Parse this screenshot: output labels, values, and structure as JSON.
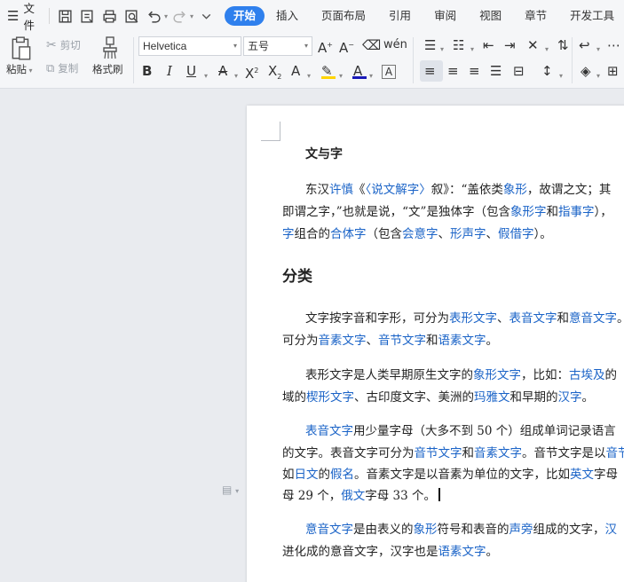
{
  "menubar": {
    "file_label": "文件",
    "tabs": [
      {
        "label": "开始",
        "active": true
      },
      {
        "label": "插入"
      },
      {
        "label": "页面布局"
      },
      {
        "label": "引用"
      },
      {
        "label": "审阅"
      },
      {
        "label": "视图"
      },
      {
        "label": "章节"
      },
      {
        "label": "开发工具"
      }
    ],
    "quick_icons": [
      "save-icon",
      "export-pdf-icon",
      "print-icon",
      "print-preview-icon",
      "undo-icon",
      "redo-icon",
      "customize-icon"
    ]
  },
  "ribbon": {
    "paste_label": "粘贴",
    "cut_label": "剪切",
    "copy_label": "复制",
    "format_painter_label": "格式刷",
    "font_name": "Helvetica",
    "font_size": "五号",
    "accent_color": "#2f80ed",
    "highlight_color": "#ffd400",
    "font_color": "#1a1ab8"
  },
  "document": {
    "title": "文与字",
    "p1": {
      "l1": [
        {
          "t": "东汉"
        },
        {
          "t": "许慎",
          "link": true
        },
        {
          "t": "《"
        },
        {
          "t": "〈说文解字〉",
          "link": true
        },
        {
          "t": "叙》："
        },
        {
          "t": "“盖依类"
        },
        {
          "t": "象形",
          "link": true
        },
        {
          "t": "，故谓之文；其"
        }
      ],
      "l2": [
        {
          "t": "即谓之字，”也就是说，“文”是独体字（包含"
        },
        {
          "t": "象形字",
          "link": true
        },
        {
          "t": "和"
        },
        {
          "t": "指事字",
          "link": true
        },
        {
          "t": "），"
        }
      ],
      "l3": [
        {
          "t": "字",
          "link": true
        },
        {
          "t": "组合的"
        },
        {
          "t": "合体字",
          "link": true
        },
        {
          "t": "（包含"
        },
        {
          "t": "会意字",
          "link": true
        },
        {
          "t": "、"
        },
        {
          "t": "形声字",
          "link": true
        },
        {
          "t": "、"
        },
        {
          "t": "假借字",
          "link": true
        },
        {
          "t": "）。"
        }
      ]
    },
    "section_heading": "分类",
    "p2": {
      "l1": [
        {
          "t": "文字按字音和字形，可分为"
        },
        {
          "t": "表形文字",
          "link": true
        },
        {
          "t": "、"
        },
        {
          "t": "表音文字",
          "link": true
        },
        {
          "t": "和"
        },
        {
          "t": "意音文字",
          "link": true
        },
        {
          "t": "。"
        }
      ],
      "l2": [
        {
          "t": "可分为"
        },
        {
          "t": "音素文字",
          "link": true
        },
        {
          "t": "、"
        },
        {
          "t": "音节文字",
          "link": true
        },
        {
          "t": "和"
        },
        {
          "t": "语素文字",
          "link": true
        },
        {
          "t": "。"
        }
      ]
    },
    "p3": {
      "l1": [
        {
          "t": "表形文字是人类早期原生文字的"
        },
        {
          "t": "象形文字",
          "link": true
        },
        {
          "t": "，比如："
        },
        {
          "t": "古埃及",
          "link": true
        },
        {
          "t": "的"
        }
      ],
      "l2": [
        {
          "t": "域的"
        },
        {
          "t": "楔形文字",
          "link": true
        },
        {
          "t": "、古印度文字、美洲的"
        },
        {
          "t": "玛雅文",
          "link": true
        },
        {
          "t": "和早期的"
        },
        {
          "t": "汉字",
          "link": true
        },
        {
          "t": "。"
        }
      ]
    },
    "p4": {
      "l1": [
        {
          "t": "表音文字",
          "link": true
        },
        {
          "t": "用少量字母（大多不到 50 个）组成单词记录语言"
        }
      ],
      "l2": [
        {
          "t": "的文字。表音文字可分为"
        },
        {
          "t": "音节文字",
          "link": true
        },
        {
          "t": "和"
        },
        {
          "t": "音素文字",
          "link": true
        },
        {
          "t": "。音节文字是以"
        },
        {
          "t": "音节",
          "link": true
        }
      ],
      "l3": [
        {
          "t": "如"
        },
        {
          "t": "日文",
          "link": true
        },
        {
          "t": "的"
        },
        {
          "t": "假名",
          "link": true
        },
        {
          "t": "。音素文字是以音素为单位的文字，比如"
        },
        {
          "t": "英文",
          "link": true
        },
        {
          "t": "字母"
        }
      ],
      "l4": [
        {
          "t": "母 29 个，"
        },
        {
          "t": "俄文",
          "link": true
        },
        {
          "t": "字母 33 个。"
        }
      ]
    },
    "p5": {
      "l1": [
        {
          "t": "意音文字",
          "link": true
        },
        {
          "t": "是由表义的"
        },
        {
          "t": "象形",
          "link": true
        },
        {
          "t": "符号和表音的"
        },
        {
          "t": "声旁",
          "link": true
        },
        {
          "t": "组成的文字，"
        },
        {
          "t": "汉",
          "link": true
        }
      ],
      "l2": [
        {
          "t": "进化成的意音文字，汉字也是"
        },
        {
          "t": "语素文字",
          "link": true
        },
        {
          "t": "。"
        }
      ]
    }
  }
}
